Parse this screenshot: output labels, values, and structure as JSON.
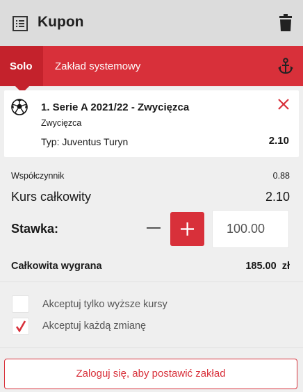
{
  "header": {
    "title": "Kupon",
    "list_icon": "list-icon",
    "trash_icon": "trash-icon"
  },
  "tabs": {
    "solo": "Solo",
    "system": "Zakład systemowy",
    "anchor_icon": "anchor-icon"
  },
  "bet": {
    "event": "1. Serie A 2021/22 - Zwycięzca",
    "market": "Zwycięzca",
    "pick": "Typ: Juventus Turyn",
    "odd": "2.10",
    "sport_icon": "soccer-ball-icon",
    "remove_icon": "close-icon"
  },
  "summary": {
    "coef_label": "Współczynnik",
    "coef_value": "0.88",
    "total_odds_label": "Kurs całkowity",
    "total_odds_value": "2.10",
    "stake_label": "Stawka:",
    "stake_value": "100.00",
    "win_label": "Całkowita wygrana",
    "win_value": "185.00  zł"
  },
  "options": [
    {
      "label": "Akceptuj tylko wyższe kursy",
      "checked": false
    },
    {
      "label": "Akceptuj każdą zmianę",
      "checked": true
    }
  ],
  "cta": {
    "login_label": "Zaloguj się, aby postawić zakład"
  },
  "colors": {
    "accent": "#d8303a",
    "header_bg": "#dcdcdc",
    "page_bg": "#efefef"
  }
}
